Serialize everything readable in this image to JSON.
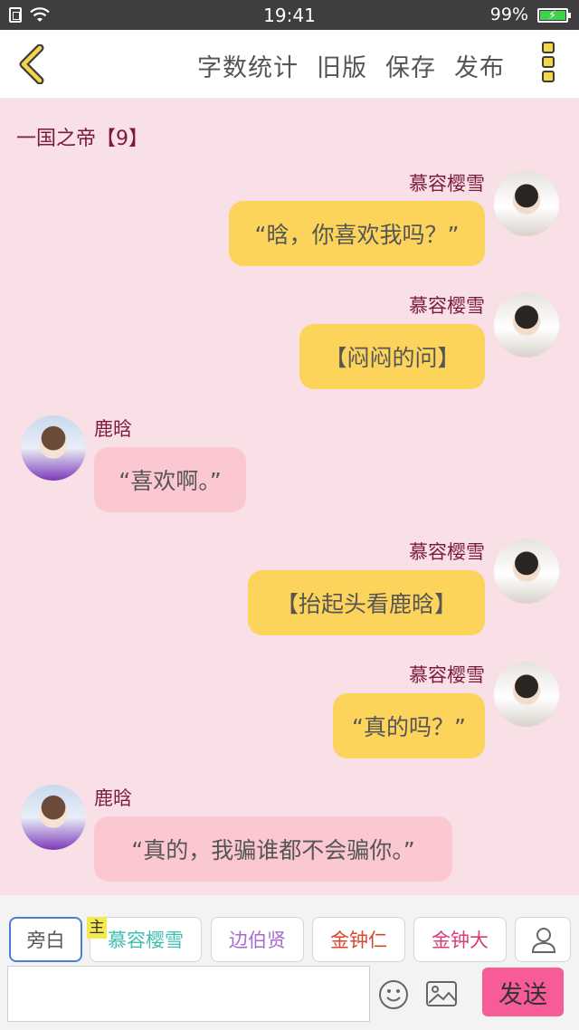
{
  "status_bar": {
    "time": "19:41",
    "battery": "99%"
  },
  "toolbar": {
    "word_count": "字数统计",
    "old_version": "旧版",
    "save": "保存",
    "publish": "发布"
  },
  "chat": {
    "title": "一国之帝【9】",
    "messages": [
      {
        "name": "慕容樱雪",
        "text": "“晗，你喜欢我吗？”",
        "side": "right",
        "color": "#fcd45c"
      },
      {
        "name": "慕容樱雪",
        "text": "【闷闷的问】",
        "side": "right",
        "color": "#fcd45c"
      },
      {
        "name": "鹿晗",
        "text": "“喜欢啊。”",
        "side": "left",
        "color": "#fbc8d1"
      },
      {
        "name": "慕容樱雪",
        "text": "【抬起头看鹿晗】",
        "side": "right",
        "color": "#fcd45c"
      },
      {
        "name": "慕容樱雪",
        "text": "“真的吗？”",
        "side": "right",
        "color": "#fcd45c"
      },
      {
        "name": "鹿晗",
        "text": "“真的，我骗谁都不会骗你。”",
        "side": "left",
        "color": "#fbc8d1"
      }
    ]
  },
  "roles": {
    "main_tag": "主",
    "items": [
      {
        "label": "旁白",
        "color": "#555555"
      },
      {
        "label": "慕容樱雪",
        "color": "#3fbfb0"
      },
      {
        "label": "边伯贤",
        "color": "#a96bd0"
      },
      {
        "label": "金钟仁",
        "color": "#d8472b"
      },
      {
        "label": "金钟大",
        "color": "#d83c7a"
      }
    ]
  },
  "composer": {
    "input_value": "",
    "send": "发送"
  }
}
